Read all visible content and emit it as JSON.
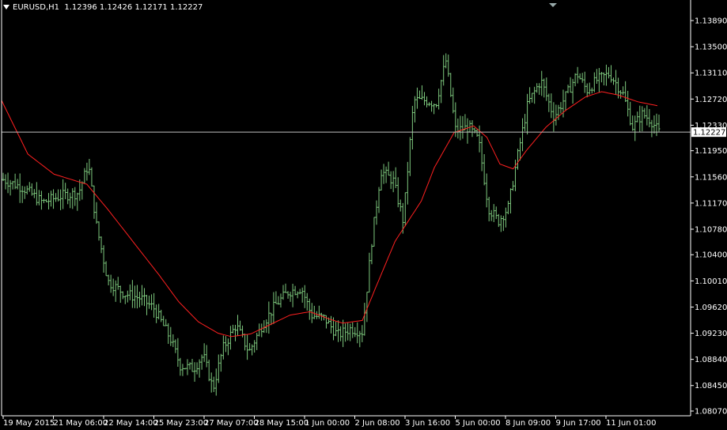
{
  "header": {
    "symbol": "EURUSD,H1",
    "ohlc": "1.12396 1.12426 1.12171 1.12227"
  },
  "colors": {
    "background": "#000000",
    "bars": "#7ec97e",
    "ma_line": "#ff2020",
    "price_line": "#c0c0c0",
    "axis": "#ffffff"
  },
  "chart_data": {
    "type": "ohlc",
    "symbol": "EURUSD",
    "timeframe": "H1",
    "current_price": 1.12227,
    "current_price_label": "1.12227",
    "y_ticks": [
      "1.13890",
      "1.13500",
      "1.13110",
      "1.12720",
      "1.12330",
      "1.11950",
      "1.11560",
      "1.11170",
      "1.10780",
      "1.10400",
      "1.10010",
      "1.09620",
      "1.09230",
      "1.08840",
      "1.08450",
      "1.08070"
    ],
    "ylim": [
      1.0807,
      1.1389
    ],
    "x_ticks": [
      "19 May 2015",
      "21 May 06:00",
      "22 May 14:00",
      "25 May 23:00",
      "27 May 07:00",
      "28 May 15:00",
      "1 Jun 00:00",
      "2 Jun 08:00",
      "3 Jun 16:00",
      "5 Jun 00:00",
      "8 Jun 09:00",
      "9 Jun 17:00",
      "11 Jun 01:00"
    ],
    "price_path": [
      [
        0,
        1.1152
      ],
      [
        0.03,
        1.114
      ],
      [
        0.06,
        1.1118
      ],
      [
        0.09,
        1.1128
      ],
      [
        0.115,
        1.1132
      ],
      [
        0.13,
        1.1175
      ],
      [
        0.142,
        1.1085
      ],
      [
        0.16,
        1.1
      ],
      [
        0.185,
        1.0982
      ],
      [
        0.21,
        1.0975
      ],
      [
        0.23,
        1.096
      ],
      [
        0.255,
        1.0915
      ],
      [
        0.27,
        1.0875
      ],
      [
        0.29,
        1.087
      ],
      [
        0.305,
        1.089
      ],
      [
        0.32,
        1.084
      ],
      [
        0.335,
        1.09
      ],
      [
        0.355,
        1.0935
      ],
      [
        0.375,
        1.0895
      ],
      [
        0.395,
        1.0935
      ],
      [
        0.415,
        1.0965
      ],
      [
        0.435,
        1.0985
      ],
      [
        0.455,
        1.099
      ],
      [
        0.47,
        1.095
      ],
      [
        0.49,
        1.0945
      ],
      [
        0.51,
        1.092
      ],
      [
        0.53,
        1.093
      ],
      [
        0.548,
        1.0925
      ],
      [
        0.562,
        1.106
      ],
      [
        0.576,
        1.1165
      ],
      [
        0.595,
        1.115
      ],
      [
        0.61,
        1.109
      ],
      [
        0.626,
        1.127
      ],
      [
        0.645,
        1.127
      ],
      [
        0.66,
        1.1265
      ],
      [
        0.675,
        1.133
      ],
      [
        0.69,
        1.1225
      ],
      [
        0.71,
        1.123
      ],
      [
        0.725,
        1.121
      ],
      [
        0.74,
        1.111
      ],
      [
        0.755,
        1.109
      ],
      [
        0.77,
        1.111
      ],
      [
        0.785,
        1.119
      ],
      [
        0.8,
        1.1265
      ],
      [
        0.82,
        1.13
      ],
      [
        0.84,
        1.1245
      ],
      [
        0.86,
        1.128
      ],
      [
        0.875,
        1.131
      ],
      [
        0.89,
        1.1285
      ],
      [
        0.905,
        1.13
      ],
      [
        0.925,
        1.131
      ],
      [
        0.945,
        1.128
      ],
      [
        0.96,
        1.123
      ],
      [
        0.975,
        1.125
      ],
      [
        0.988,
        1.124
      ],
      [
        1,
        1.12227
      ]
    ],
    "ma_path": [
      [
        0,
        1.127
      ],
      [
        0.04,
        1.119
      ],
      [
        0.08,
        1.116
      ],
      [
        0.13,
        1.1145
      ],
      [
        0.16,
        1.111
      ],
      [
        0.2,
        1.106
      ],
      [
        0.24,
        1.101
      ],
      [
        0.27,
        1.097
      ],
      [
        0.3,
        1.094
      ],
      [
        0.33,
        1.0923
      ],
      [
        0.35,
        1.0918
      ],
      [
        0.38,
        1.0922
      ],
      [
        0.41,
        1.0936
      ],
      [
        0.44,
        1.095
      ],
      [
        0.47,
        1.0955
      ],
      [
        0.5,
        1.0944
      ],
      [
        0.52,
        1.0938
      ],
      [
        0.55,
        1.0942
      ],
      [
        0.57,
        1.099
      ],
      [
        0.6,
        1.106
      ],
      [
        0.62,
        1.109
      ],
      [
        0.64,
        1.112
      ],
      [
        0.66,
        1.117
      ],
      [
        0.69,
        1.1222
      ],
      [
        0.72,
        1.1232
      ],
      [
        0.74,
        1.1215
      ],
      [
        0.76,
        1.1175
      ],
      [
        0.78,
        1.1168
      ],
      [
        0.8,
        1.1195
      ],
      [
        0.83,
        1.123
      ],
      [
        0.86,
        1.1255
      ],
      [
        0.89,
        1.1275
      ],
      [
        0.915,
        1.1283
      ],
      [
        0.94,
        1.1278
      ],
      [
        0.97,
        1.1268
      ],
      [
        1,
        1.1262
      ]
    ]
  }
}
